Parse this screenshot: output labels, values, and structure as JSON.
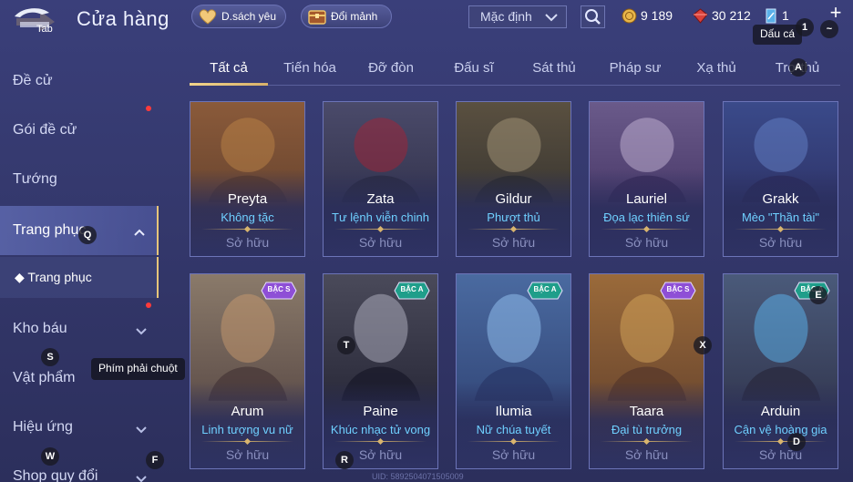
{
  "header": {
    "back_key": "Tab",
    "title": "Cửa hàng",
    "wishlist_label": "D.sách yêu",
    "exchange_label": "Đổi mảnh",
    "sort_value": "Mặc định",
    "currencies": [
      {
        "name": "gold",
        "value": "9 189"
      },
      {
        "name": "ruby",
        "value": "30 212"
      },
      {
        "name": "shard",
        "value": "1"
      }
    ],
    "tooltip": "Dấu cá"
  },
  "sidebar": {
    "items": [
      {
        "label": "Đề cử"
      },
      {
        "label": "Gói đề cử"
      },
      {
        "label": "Tướng"
      },
      {
        "label": "Trang phục"
      },
      {
        "label": "Kho báu"
      },
      {
        "label": "Vật phẩm"
      },
      {
        "label": "Hiệu ứng"
      },
      {
        "label": "Shop quy đổi"
      }
    ],
    "sub_item": "Trang phục",
    "tooltip": "Phím phải chuột"
  },
  "tabs": [
    "Tất cả",
    "Tiến hóa",
    "Đỡ đòn",
    "Đấu sĩ",
    "Sát thủ",
    "Pháp sư",
    "Xạ thủ",
    "Trợ thủ"
  ],
  "cards": [
    {
      "name": "Preyta",
      "skin": "Không tặc",
      "status": "Sở hữu",
      "tier": ""
    },
    {
      "name": "Zata",
      "skin": "Tư lệnh viễn chinh",
      "status": "Sở hữu",
      "tier": ""
    },
    {
      "name": "Gildur",
      "skin": "Phượt thủ",
      "status": "Sở hữu",
      "tier": ""
    },
    {
      "name": "Lauriel",
      "skin": "Đọa lạc thiên sứ",
      "status": "Sở hữu",
      "tier": ""
    },
    {
      "name": "Grakk",
      "skin": "Mèo \"Thần tài\"",
      "status": "Sở hữu",
      "tier": ""
    },
    {
      "name": "Arum",
      "skin": "Linh tượng vu nữ",
      "status": "Sở hữu",
      "tier": "BẬC S"
    },
    {
      "name": "Paine",
      "skin": "Khúc nhạc tử vong",
      "status": "Sở hữu",
      "tier": "BẬC A"
    },
    {
      "name": "Ilumia",
      "skin": "Nữ chúa tuyết",
      "status": "Sở hữu",
      "tier": "BẬC A"
    },
    {
      "name": "Taara",
      "skin": "Đại tù trưởng",
      "status": "Sở hữu",
      "tier": "BẬC S"
    },
    {
      "name": "Arduin",
      "skin": "Cận vệ hoàng gia",
      "status": "Sở hữu",
      "tier": "BẬC A"
    }
  ],
  "key_hints": [
    "1",
    "~",
    "A",
    "Q",
    "S",
    "W",
    "F",
    "T",
    "R",
    "X",
    "E",
    "D"
  ],
  "uid": "UID: 5892504071505009",
  "colors": {
    "accent_gold": "#e6c57a",
    "skin_text": "#6fd0ff",
    "tier_s": "#8e4fd6",
    "tier_a": "#1f9e8a",
    "notify": "#ff3a3a"
  }
}
